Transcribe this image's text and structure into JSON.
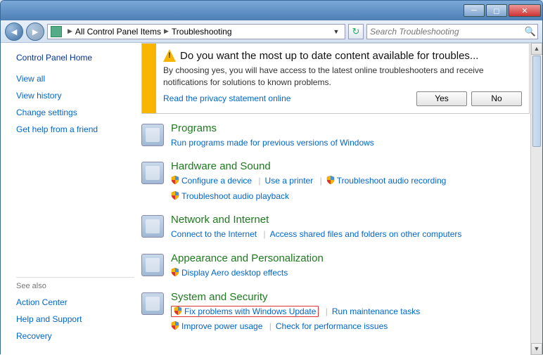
{
  "breadcrumb": {
    "parent": "All Control Panel Items",
    "current": "Troubleshooting"
  },
  "search": {
    "placeholder": "Search Troubleshooting"
  },
  "sidebar": {
    "home": "Control Panel Home",
    "links": [
      "View all",
      "View history",
      "Change settings",
      "Get help from a friend"
    ],
    "seealso_label": "See also",
    "seealso": [
      "Action Center",
      "Help and Support",
      "Recovery"
    ]
  },
  "infobar": {
    "title": "Do you want the most up to date content available for troubles...",
    "text": "By choosing yes, you will have access to the latest online troubleshooters and receive notifications for solutions to known problems.",
    "privacy": "Read the privacy statement online",
    "yes": "Yes",
    "no": "No"
  },
  "cats": {
    "programs": {
      "title": "Programs",
      "l1": "Run programs made for previous versions of Windows"
    },
    "hardware": {
      "title": "Hardware and Sound",
      "l1": "Configure a device",
      "l2": "Use a printer",
      "l3": "Troubleshoot audio recording",
      "l4": "Troubleshoot audio playback"
    },
    "network": {
      "title": "Network and Internet",
      "l1": "Connect to the Internet",
      "l2": "Access shared files and folders on other computers"
    },
    "appearance": {
      "title": "Appearance and Personalization",
      "l1": "Display Aero desktop effects"
    },
    "security": {
      "title": "System and Security",
      "l1": "Fix problems with Windows Update",
      "l2": "Run maintenance tasks",
      "l3": "Improve power usage",
      "l4": "Check for performance issues"
    }
  }
}
